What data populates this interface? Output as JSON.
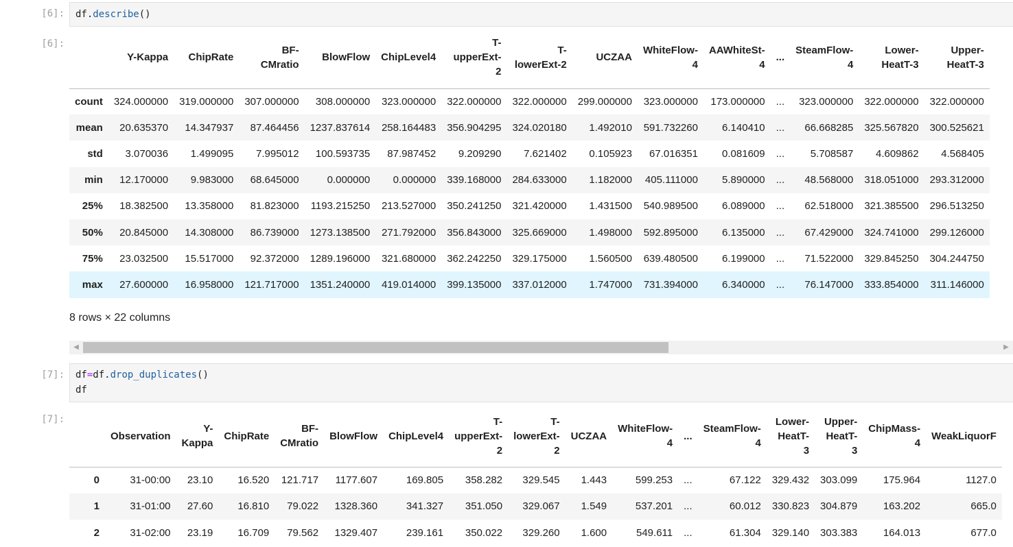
{
  "cell6": {
    "in_prompt": "[6]:",
    "out_prompt": "[6]:",
    "code": {
      "var": "df",
      "dot": ".",
      "method": "describe",
      "args": "()"
    },
    "columns": [
      "Y-Kappa",
      "ChipRate",
      "BF-CMratio",
      "BlowFlow",
      "ChipLevel4",
      "T-upperExt-2",
      "T-lowerExt-2",
      "UCZAA",
      "WhiteFlow-4",
      "AAWhiteSt-4",
      "...",
      "SteamFlow-4",
      "Lower-HeatT-3",
      "Upper-HeatT-3"
    ],
    "column_lines": [
      [
        "Y-Kappa"
      ],
      [
        "ChipRate"
      ],
      [
        "BF-",
        "CMratio"
      ],
      [
        "BlowFlow"
      ],
      [
        "ChipLevel4"
      ],
      [
        "T-",
        "upperExt-",
        "2"
      ],
      [
        "T-",
        "lowerExt-2"
      ],
      [
        "UCZAA"
      ],
      [
        "WhiteFlow-",
        "4"
      ],
      [
        "AAWhiteSt-",
        "4"
      ],
      [
        "..."
      ],
      [
        "SteamFlow-",
        "4"
      ],
      [
        "Lower-",
        "HeatT-3"
      ],
      [
        "Upper-",
        "HeatT-3"
      ]
    ],
    "rows": [
      {
        "label": "count",
        "values": [
          "324.000000",
          "319.000000",
          "307.000000",
          "308.000000",
          "323.000000",
          "322.000000",
          "322.000000",
          "299.000000",
          "323.000000",
          "173.000000",
          "...",
          "323.000000",
          "322.000000",
          "322.000000"
        ]
      },
      {
        "label": "mean",
        "values": [
          "20.635370",
          "14.347937",
          "87.464456",
          "1237.837614",
          "258.164483",
          "356.904295",
          "324.020180",
          "1.492010",
          "591.732260",
          "6.140410",
          "...",
          "66.668285",
          "325.567820",
          "300.525621"
        ]
      },
      {
        "label": "std",
        "values": [
          "3.070036",
          "1.499095",
          "7.995012",
          "100.593735",
          "87.987452",
          "9.209290",
          "7.621402",
          "0.105923",
          "67.016351",
          "0.081609",
          "...",
          "5.708587",
          "4.609862",
          "4.568405"
        ]
      },
      {
        "label": "min",
        "values": [
          "12.170000",
          "9.983000",
          "68.645000",
          "0.000000",
          "0.000000",
          "339.168000",
          "284.633000",
          "1.182000",
          "405.111000",
          "5.890000",
          "...",
          "48.568000",
          "318.051000",
          "293.312000"
        ]
      },
      {
        "label": "25%",
        "values": [
          "18.382500",
          "13.358000",
          "81.823000",
          "1193.215250",
          "213.527000",
          "350.241250",
          "321.420000",
          "1.431500",
          "540.989500",
          "6.089000",
          "...",
          "62.518000",
          "321.385500",
          "296.513250"
        ]
      },
      {
        "label": "50%",
        "values": [
          "20.845000",
          "14.308000",
          "86.739000",
          "1273.138500",
          "271.792000",
          "356.843000",
          "325.669000",
          "1.498000",
          "592.895000",
          "6.135000",
          "...",
          "67.429000",
          "324.741000",
          "299.126000"
        ]
      },
      {
        "label": "75%",
        "values": [
          "23.032500",
          "15.517000",
          "92.372000",
          "1289.196000",
          "321.680000",
          "362.242250",
          "329.175000",
          "1.560500",
          "639.480500",
          "6.199000",
          "...",
          "71.522000",
          "329.845250",
          "304.244750"
        ]
      },
      {
        "label": "max",
        "values": [
          "27.600000",
          "16.958000",
          "121.717000",
          "1351.240000",
          "419.014000",
          "399.135000",
          "337.012000",
          "1.747000",
          "731.394000",
          "6.340000",
          "...",
          "76.147000",
          "333.854000",
          "311.146000"
        ]
      }
    ],
    "footer": "8 rows × 22 columns"
  },
  "scrollbar": {
    "left_arrow": "◀",
    "right_arrow": "▶"
  },
  "cell7": {
    "in_prompt": "[7]:",
    "out_prompt": "[7]:",
    "code_line1": {
      "lhs": "df",
      "eq": "=",
      "obj": "df",
      "dot": ".",
      "method": "drop_duplicates",
      "args": "()"
    },
    "code_line2": "df",
    "column_lines": [
      [
        "Observation"
      ],
      [
        "Y-",
        "Kappa"
      ],
      [
        "ChipRate"
      ],
      [
        "BF-",
        "CMratio"
      ],
      [
        "BlowFlow"
      ],
      [
        "ChipLevel4"
      ],
      [
        "T-",
        "upperExt-",
        "2"
      ],
      [
        "T-",
        "lowerExt-",
        "2"
      ],
      [
        "UCZAA"
      ],
      [
        "WhiteFlow-",
        "4"
      ],
      [
        "..."
      ],
      [
        "SteamFlow-",
        "4"
      ],
      [
        "Lower-",
        "HeatT-",
        "3"
      ],
      [
        "Upper-",
        "HeatT-",
        "3"
      ],
      [
        "ChipMass-",
        "4"
      ],
      [
        "WeakLiquorF"
      ]
    ],
    "rows": [
      {
        "label": "0",
        "values": [
          "31-00:00",
          "23.10",
          "16.520",
          "121.717",
          "1177.607",
          "169.805",
          "358.282",
          "329.545",
          "1.443",
          "599.253",
          "...",
          "67.122",
          "329.432",
          "303.099",
          "175.964",
          "1127.0"
        ]
      },
      {
        "label": "1",
        "values": [
          "31-01:00",
          "27.60",
          "16.810",
          "79.022",
          "1328.360",
          "341.327",
          "351.050",
          "329.067",
          "1.549",
          "537.201",
          "...",
          "60.012",
          "330.823",
          "304.879",
          "163.202",
          "665.0"
        ]
      },
      {
        "label": "2",
        "values": [
          "31-02:00",
          "23.19",
          "16.709",
          "79.562",
          "1329.407",
          "239.161",
          "350.022",
          "329.260",
          "1.600",
          "549.611",
          "...",
          "61.304",
          "329.140",
          "303.383",
          "164.013",
          "677.0"
        ]
      }
    ]
  }
}
